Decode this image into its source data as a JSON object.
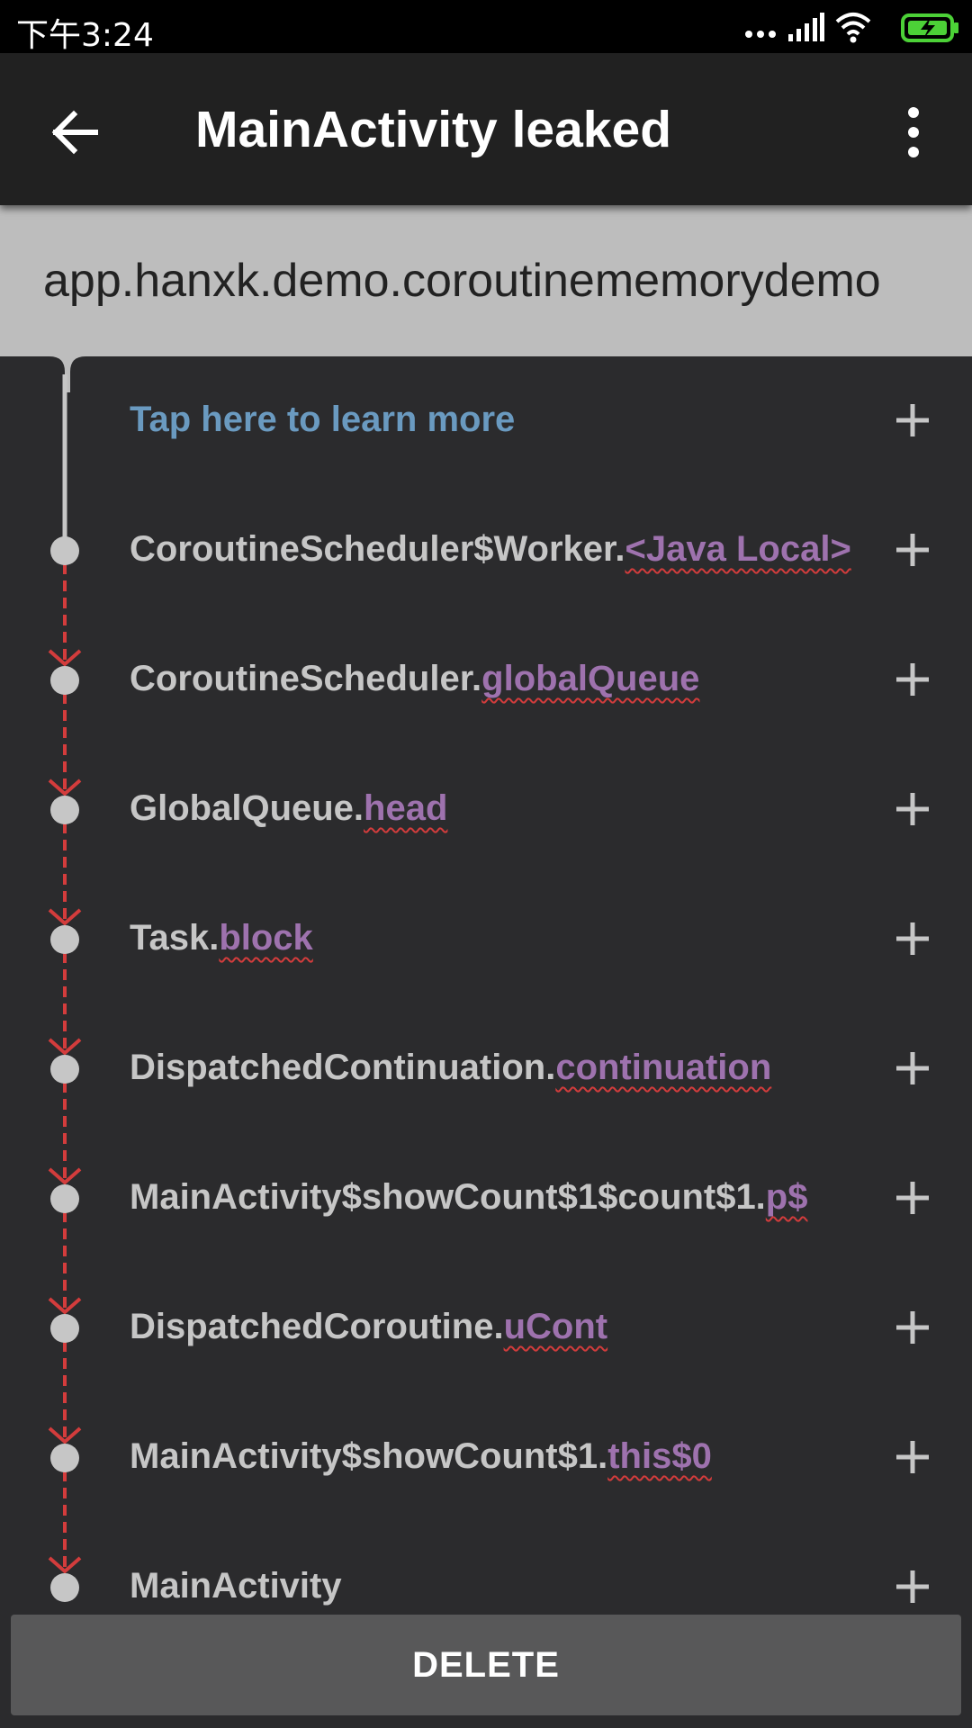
{
  "status_bar": {
    "time": "下午3:24",
    "icons": [
      "more-dots-icon",
      "signal-icon",
      "wifi-icon",
      "battery-charging-icon"
    ],
    "battery_color": "#4cd137"
  },
  "app_bar": {
    "back_icon": "arrow-back-icon",
    "title": "MainActivity leaked",
    "menu_icon": "more-vert-icon"
  },
  "package_name": "app.hanxk.demo.coroutinememorydemo",
  "trace": {
    "learn_more": "Tap here to learn more",
    "items": [
      {
        "class_name": "CoroutineScheduler$Worker.",
        "field": "<Java Local>"
      },
      {
        "class_name": "CoroutineScheduler.",
        "field": "globalQueue"
      },
      {
        "class_name": "GlobalQueue.",
        "field": "head"
      },
      {
        "class_name": "Task.",
        "field": "block"
      },
      {
        "class_name": "DispatchedContinuation.",
        "field": "continuation"
      },
      {
        "class_name": "MainActivity$showCount$1$count$1.",
        "field": "p$"
      },
      {
        "class_name": "DispatchedCoroutine.",
        "field": "uCont"
      },
      {
        "class_name": "MainActivity$showCount$1.",
        "field": "this$0"
      },
      {
        "class_name": "MainActivity",
        "field": ""
      }
    ],
    "colors": {
      "leak_line": "#d33c3c",
      "field_text": "#9e72ae",
      "link_text": "#6a9ac0",
      "node": "#c6c6c6"
    }
  },
  "delete_button": {
    "label": "DELETE"
  }
}
